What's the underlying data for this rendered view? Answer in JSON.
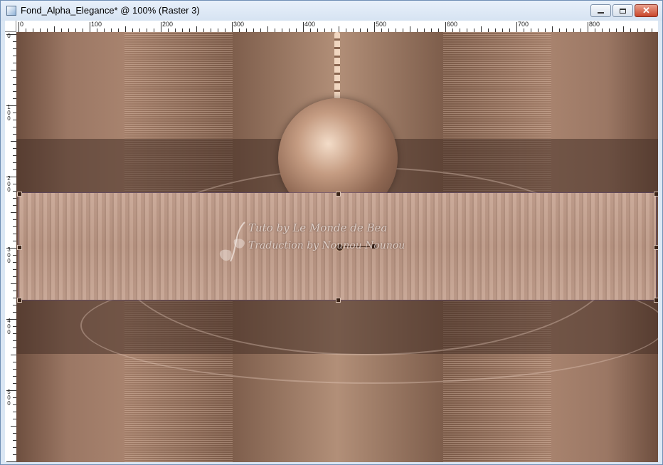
{
  "window": {
    "title": "Fond_Alpha_Elegance* @ 100% (Raster 3)",
    "controls": {
      "minimize": "",
      "maximize": "",
      "close": "✕"
    }
  },
  "ruler": {
    "horizontal_labels": [
      "0",
      "100",
      "200",
      "300",
      "400",
      "500",
      "600",
      "700",
      "800"
    ],
    "vertical_labels": [
      "0",
      "100",
      "200",
      "300",
      "400",
      "500"
    ]
  },
  "canvas": {
    "watermark": {
      "line1": "Tuto by Le Monde de Bea",
      "line2": "Traduction by Nounou Nounou"
    }
  },
  "colors": {
    "title_bar": "#dbe7f4",
    "close_button": "#c9462b",
    "canvas_base": "#8f6c58",
    "wood_band": "#c0a08e"
  }
}
